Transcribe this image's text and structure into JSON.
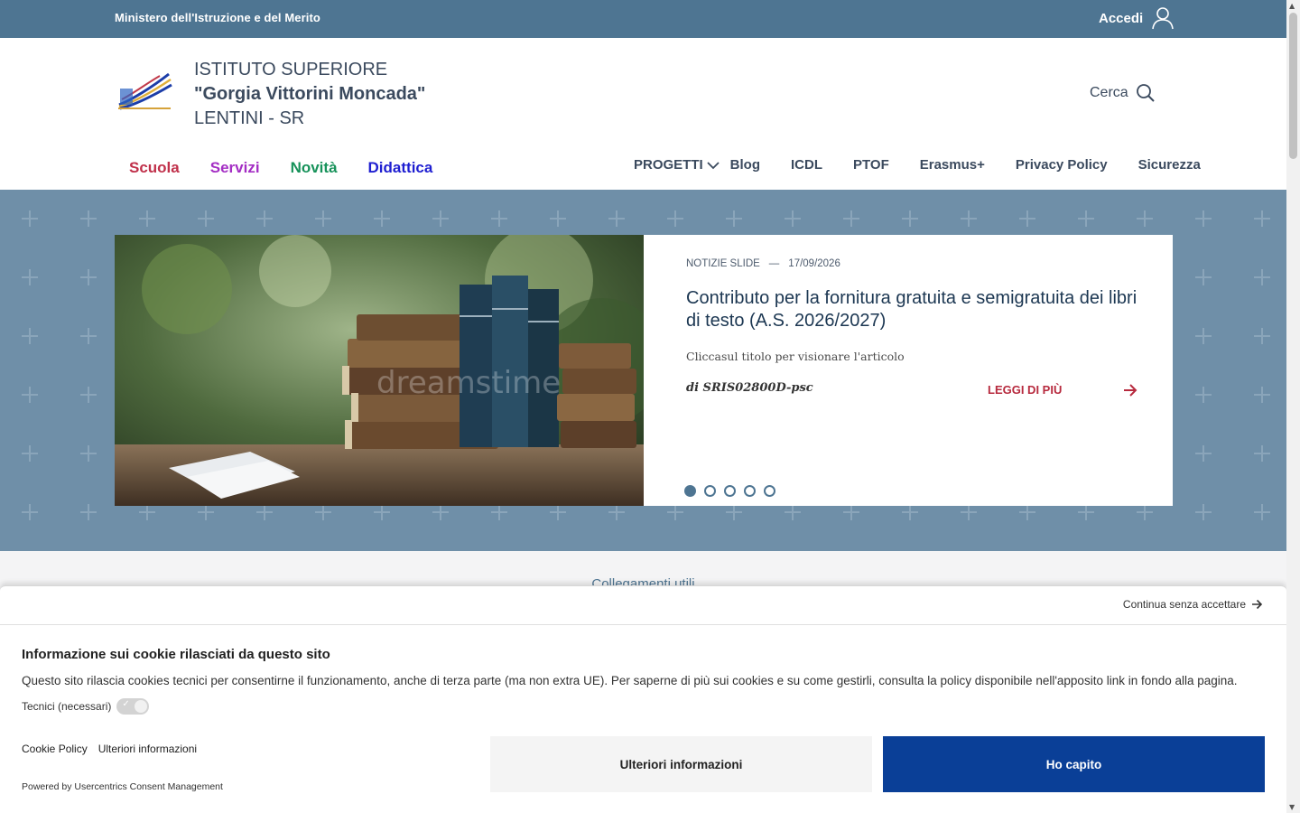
{
  "topbar": {
    "ministry": "Ministero dell'Istruzione e del Merito",
    "login_label": "Accedi"
  },
  "header": {
    "school_line1": "ISTITUTO SUPERIORE",
    "school_line2": "\"Gorgia Vittorini Moncada\"",
    "school_line3": "LENTINI - SR",
    "search_label": "Cerca"
  },
  "main_nav": [
    {
      "label": "Scuola",
      "color": "#c0304a"
    },
    {
      "label": "Servizi",
      "color": "#a42ec4"
    },
    {
      "label": "Novità",
      "color": "#17925a"
    },
    {
      "label": "Didattica",
      "color": "#1f1fd1"
    }
  ],
  "secondary_nav": [
    "PROGETTI",
    "Blog",
    "ICDL",
    "PTOF",
    "Erasmus+",
    "Privacy Policy",
    "Sicurezza"
  ],
  "slide": {
    "category": "NOTIZIE SLIDE",
    "separator": "—",
    "date": "17/09/2026",
    "title": "Contributo per la fornitura gratuita e semigratuita dei libri di testo (A.S. 2026/2027)",
    "description": "Cliccasul titolo per visionare l'articolo",
    "author": "di SRIS02800D-psc",
    "read_more": "LEGGI DI PIÙ",
    "dots_count": 5,
    "active_dot": 1,
    "watermark": "dreamstime"
  },
  "useful_links": "Collegamenti utili",
  "cookie": {
    "continue_label": "Continua senza accettare",
    "title": "Informazione sui cookie rilasciati da questo sito",
    "text": "Questo sito rilascia cookies tecnici per consentirne il funzionamento, anche di terza parte (ma non extra UE). Per saperne di più sui cookies e su come gestirli, consulta la policy disponibile nell'apposito link in fondo alla pagina.",
    "technical_label": "Tecnici (necessari)",
    "link_policy": "Cookie Policy",
    "link_more": "Ulteriori informazioni",
    "btn_more": "Ulteriori informazioni",
    "btn_ok": "Ho capito",
    "powered": "Powered by Usercentrics Consent Management"
  },
  "colors": {
    "brand": "#4e7592",
    "accent_red": "#b72a3e",
    "button_blue": "#0a3f97"
  }
}
